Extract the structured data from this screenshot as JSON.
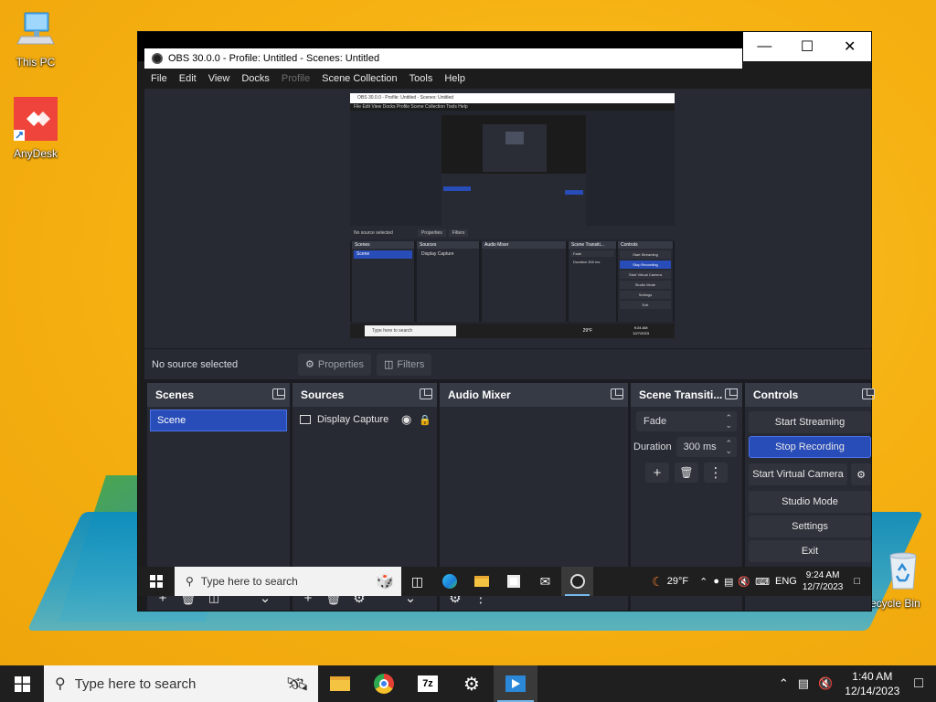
{
  "desktop": {
    "icons": [
      {
        "label": "This PC",
        "icon": "computer-icon"
      },
      {
        "label": "AnyDesk",
        "icon": "anydesk-icon"
      },
      {
        "label": "Recycle Bin",
        "icon": "recycle-bin-icon",
        "visible_label": "ecycle Bin"
      }
    ]
  },
  "obs": {
    "title": "OBS 30.0.0 - Profile: Untitled - Scenes: Untitled",
    "menu": [
      "File",
      "Edit",
      "View",
      "Docks",
      "Profile",
      "Scene Collection",
      "Tools",
      "Help"
    ],
    "menu_disabled": "Profile",
    "context_bar": {
      "status": "No source selected",
      "properties": "Properties",
      "filters": "Filters"
    },
    "docks": {
      "scenes": {
        "title": "Scenes",
        "items": [
          "Scene"
        ]
      },
      "sources": {
        "title": "Sources",
        "items": [
          "Display Capture"
        ]
      },
      "audio_mixer": {
        "title": "Audio Mixer"
      },
      "transitions": {
        "title": "Scene Transiti...",
        "transition": "Fade",
        "duration_label": "Duration",
        "duration_value": "300 ms"
      },
      "controls": {
        "title": "Controls",
        "buttons": [
          "Start Streaming",
          "Stop Recording",
          "Start Virtual Camera",
          "Studio Mode",
          "Settings",
          "Exit"
        ],
        "active_button": "Stop Recording"
      }
    },
    "nested_preview": {
      "title": "OBS 30.0.0 - Profile: Untitled - Scenes: Untitled",
      "status": "No source selected",
      "properties": "Properties",
      "filters": "Filters",
      "scenes": "Scenes",
      "sources": "Sources",
      "audio_mixer": "Audio Mixer",
      "transitions": "Scene Transiti...",
      "controls": "Controls",
      "scene_item": "Scene",
      "source_item": "Display Capture",
      "fade": "Fade",
      "duration": "Duration",
      "duration_value": "300 ms",
      "ctrl_buttons": [
        "Start Streaming",
        "Stop Recording",
        "Start Virtual Camera",
        "Studio Mode",
        "Settings",
        "Exit"
      ],
      "search": "Type here to search",
      "temp": "29°F",
      "time": "9:24 AM",
      "date": "12/7/2023"
    }
  },
  "guest_taskbar": {
    "search_placeholder": "Type here to search",
    "weather": "29°F",
    "language": "ENG",
    "time": "9:24 AM",
    "date": "12/7/2023"
  },
  "host_taskbar": {
    "search_placeholder": "Type here to search",
    "time": "1:40 AM",
    "date": "12/14/2023"
  },
  "colors": {
    "accent": "#284cb8",
    "panel": "#272a33",
    "dock_header": "#363a45",
    "desktop": "#f7b313",
    "taskbar": "#1f1f1f"
  }
}
